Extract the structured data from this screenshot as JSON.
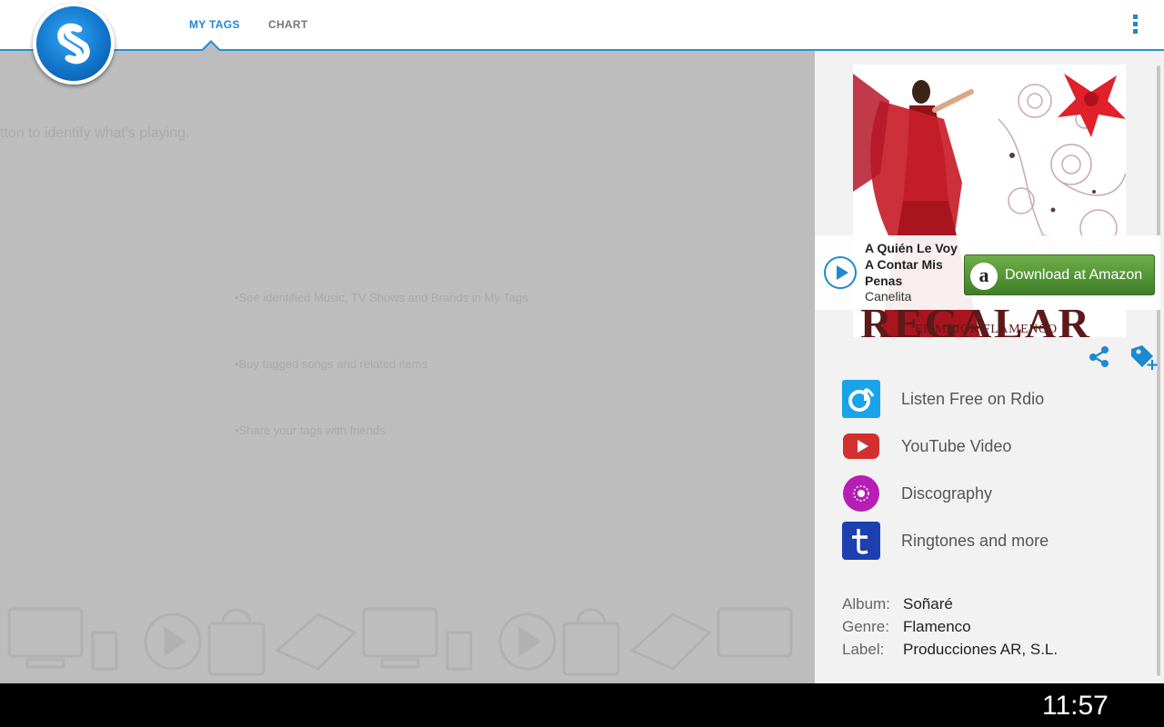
{
  "app": {
    "logo_icon": "shazam-logo",
    "tabs": [
      {
        "label": "MY TAGS",
        "active": true
      },
      {
        "label": "CHART",
        "active": false
      }
    ],
    "overflow_icon": "overflow-menu-icon",
    "accent": "#1e88d0"
  },
  "main": {
    "hint": "tton to identify what's playing.",
    "bullets": [
      "•See identified Music, TV Shows and Brands in My Tags",
      "•Buy tagged songs and related items",
      "•Share your tags with friends"
    ]
  },
  "panel": {
    "cover": {
      "title": "REGALAR",
      "subtitle": "EL MEJOR FLAMENCO"
    },
    "track": {
      "title_lines": [
        "A Quién Le Voy",
        "A Contar Mis",
        "Penas"
      ],
      "artist": "Canelita"
    },
    "amazon": {
      "label": "Download at Amazon",
      "color": "#4e9232"
    },
    "actions": [
      {
        "label": "Listen Free on Rdio",
        "icon": "rdio-icon",
        "color": "#1aa3e8"
      },
      {
        "label": "YouTube Video",
        "icon": "youtube-icon",
        "color": "#d32f2f"
      },
      {
        "label": "Discography",
        "icon": "discography-icon",
        "color": "#b61eb5"
      },
      {
        "label": "Ringtones and more",
        "icon": "ringtones-icon",
        "color": "#1e3fae"
      }
    ],
    "meta": [
      {
        "key": "Album:",
        "value": "Soñaré"
      },
      {
        "key": "Genre:",
        "value": "Flamenco"
      },
      {
        "key": "Label:",
        "value": "Producciones AR, S.L."
      }
    ]
  },
  "system_bar": {
    "time": "11:57",
    "nav_icons": [
      "back-icon",
      "home-icon",
      "recent-apps-icon",
      "screenshot-icon",
      "up-chevron-icon"
    ],
    "status_icons": [
      "usb-icon",
      "facebook-icon",
      "gmail-icon",
      "download-icon",
      "wifi-icon",
      "battery-icon"
    ]
  }
}
